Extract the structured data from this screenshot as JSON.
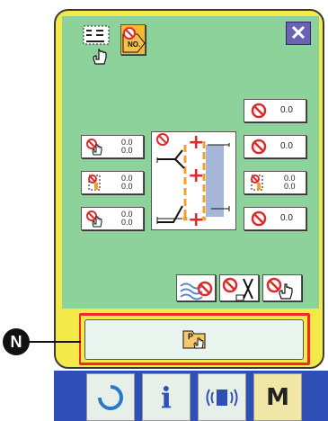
{
  "title_icons": {
    "pattern_icon": "pattern-select-icon",
    "no_icon_label": "NO."
  },
  "close_button": {
    "label": "✕"
  },
  "values": {
    "top_right": "0.0",
    "mid_right": "0.0",
    "lower_right": "0.0",
    "left_top": {
      "line1": "0.0",
      "line2": "0.0"
    },
    "left_mid": {
      "line1": "0.0",
      "line2": "0.0"
    },
    "left_bottom": {
      "line1": "0.0",
      "line2": "0.0"
    },
    "right_mid": {
      "line1": "0.0",
      "line2": "0.0"
    }
  },
  "bottom_button": {
    "label": "P"
  },
  "marker": {
    "label": "N"
  },
  "taskbar": {
    "info_label": "i",
    "mode_label": "M"
  },
  "colors": {
    "frame": "#f3ea49",
    "panel": "#8ed29b",
    "highlight": "#f02a2a",
    "taskbar": "#2f4fb7"
  }
}
